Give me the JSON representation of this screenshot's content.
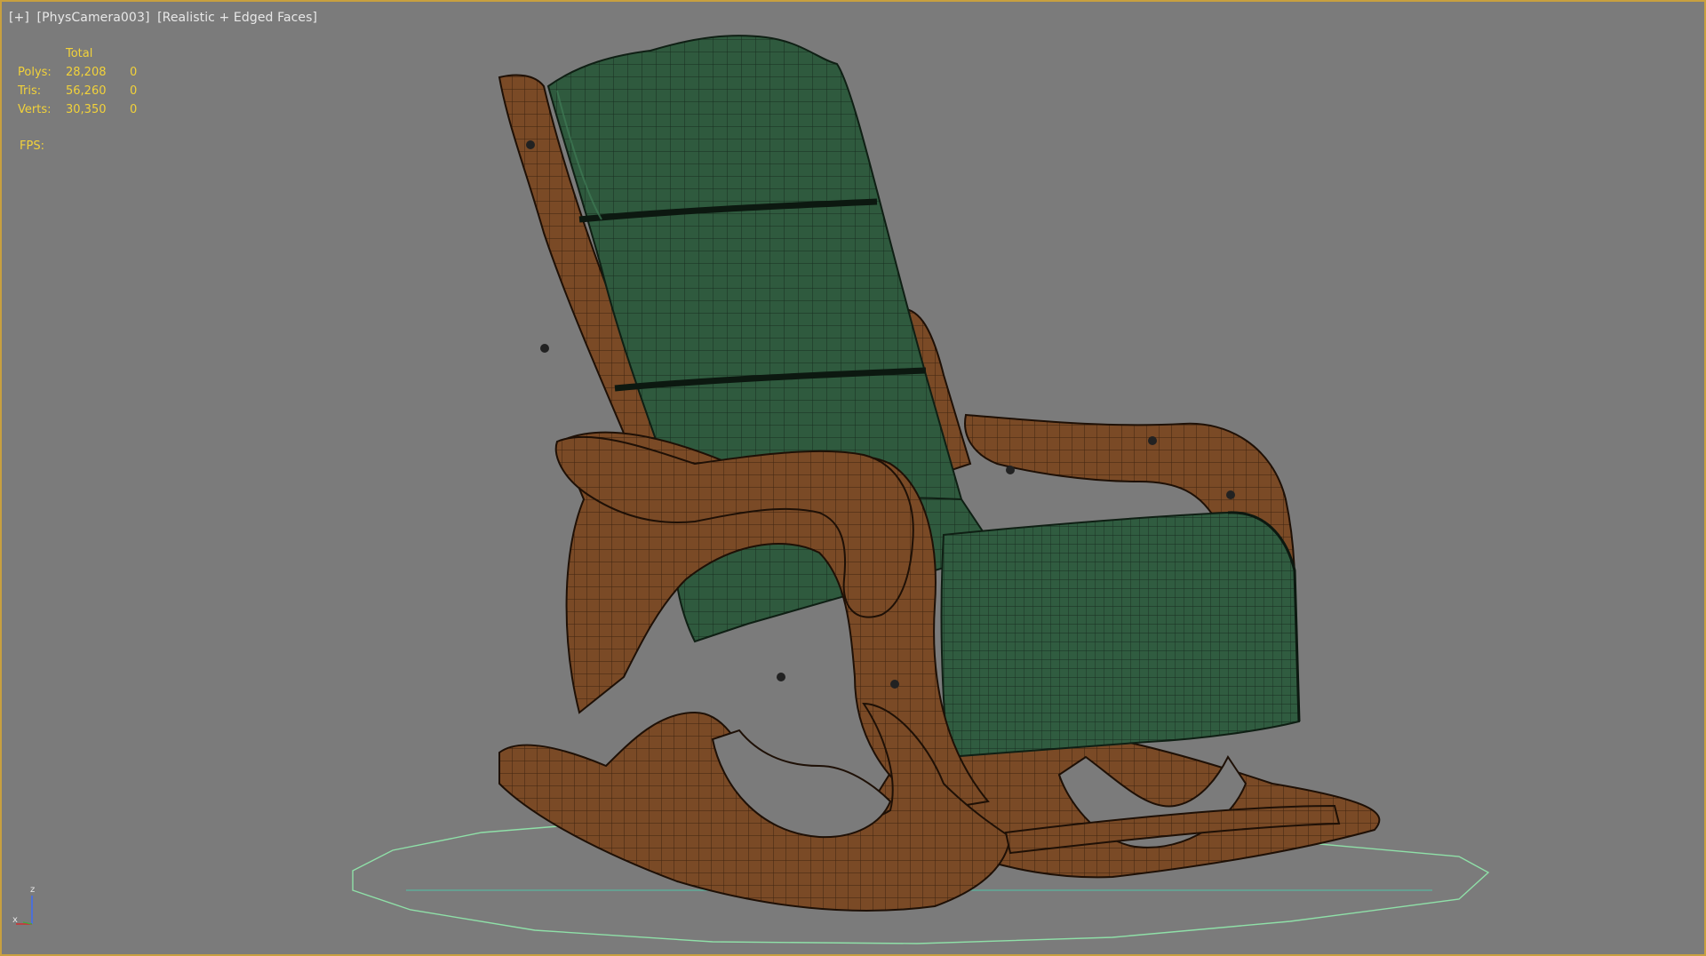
{
  "viewport": {
    "label_menu": "[+]",
    "label_camera": "[PhysCamera003]",
    "label_shading": "[Realistic + Edged Faces]"
  },
  "stats": {
    "header": "Total",
    "rows": [
      {
        "label": "Polys:",
        "total": "28,208",
        "selected": "0"
      },
      {
        "label": "Tris:",
        "total": "56,260",
        "selected": "0"
      },
      {
        "label": "Verts:",
        "total": "30,350",
        "selected": "0"
      }
    ],
    "fps_label": "FPS:"
  },
  "axis_gizmo": {
    "z": "z",
    "x": "x"
  },
  "colors": {
    "viewport_bg": "#7b7b7b",
    "active_border": "#c8a040",
    "stats_text": "#f2d23a",
    "cushion": "#2f5a3e",
    "wood": "#7a4a26",
    "ground_ring": "#8fe0a8"
  },
  "scene": {
    "object": "rocking-chair"
  }
}
